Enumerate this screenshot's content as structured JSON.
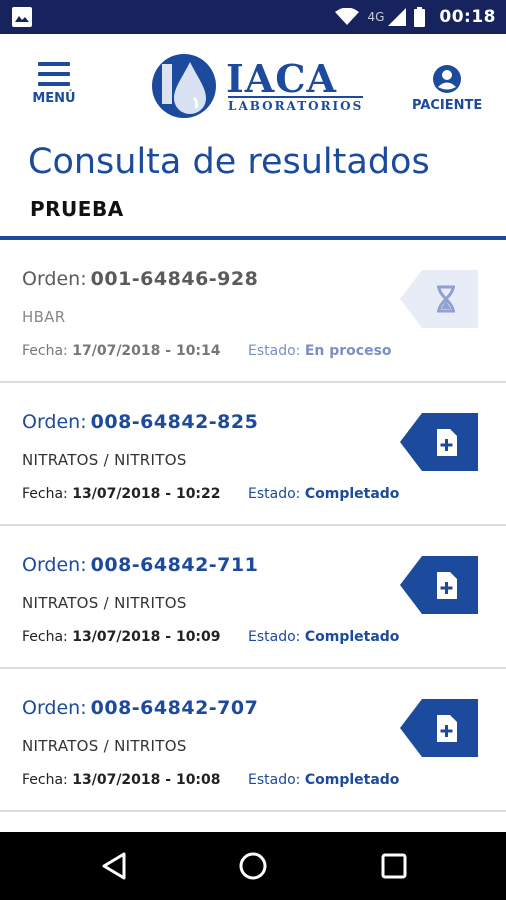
{
  "status_bar": {
    "network": "4G",
    "time": "00:18",
    "icons": [
      "image-icon",
      "wifi-icon",
      "signal-icon",
      "battery-icon"
    ]
  },
  "header": {
    "menu_label": "MENÚ",
    "logo_brand": "IACA",
    "logo_sub": "LABORATORIOS",
    "patient_label": "PACIENTE"
  },
  "page": {
    "title": "Consulta de resultados",
    "subtitle": "PRUEBA"
  },
  "orders": [
    {
      "orden_label": "Orden:",
      "orden_number": "001-64846-928",
      "test": "HBAR",
      "fecha_label": "Fecha:",
      "fecha_value": "17/07/2018 - 10:14",
      "estado_label": "Estado:",
      "estado_value": "En proceso",
      "status_icon": "hourglass-icon"
    },
    {
      "orden_label": "Orden:",
      "orden_number": "008-64842-825",
      "test": "NITRATOS / NITRITOS",
      "fecha_label": "Fecha:",
      "fecha_value": "13/07/2018 - 10:22",
      "estado_label": "Estado:",
      "estado_value": "Completado",
      "status_icon": "document-plus-icon"
    },
    {
      "orden_label": "Orden:",
      "orden_number": "008-64842-711",
      "test": "NITRATOS / NITRITOS",
      "fecha_label": "Fecha:",
      "fecha_value": "13/07/2018 - 10:09",
      "estado_label": "Estado:",
      "estado_value": "Completado",
      "status_icon": "document-plus-icon"
    },
    {
      "orden_label": "Orden:",
      "orden_number": "008-64842-707",
      "test": "NITRATOS / NITRITOS",
      "fecha_label": "Fecha:",
      "fecha_value": "13/07/2018 - 10:08",
      "estado_label": "Estado:",
      "estado_value": "Completado",
      "status_icon": "document-plus-icon"
    }
  ],
  "colors": {
    "primary": "#1c4a9c",
    "status_bar": "#16235c",
    "pending_badge": "#e8ecf6",
    "pending_text": "#7b8fc4"
  },
  "nav_bar": {
    "buttons": [
      "back-icon",
      "home-icon",
      "recents-icon"
    ]
  }
}
